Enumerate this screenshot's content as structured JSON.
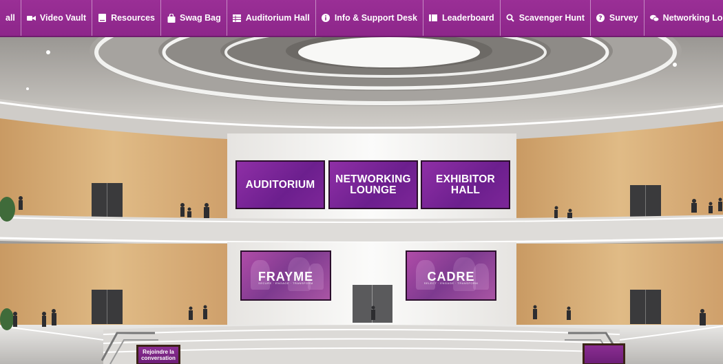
{
  "nav": {
    "items": [
      {
        "label": "all",
        "icon": ""
      },
      {
        "label": "Video Vault",
        "icon": "video-camera-icon"
      },
      {
        "label": "Resources",
        "icon": "book-icon"
      },
      {
        "label": "Swag Bag",
        "icon": "shopping-bag-icon"
      },
      {
        "label": "Auditorium Hall",
        "icon": "table-icon"
      },
      {
        "label": "Info & Support Desk",
        "icon": "info-circle-icon"
      },
      {
        "label": "Leaderboard",
        "icon": "list-icon"
      },
      {
        "label": "Scavenger Hunt",
        "icon": "search-icon"
      },
      {
        "label": "Survey",
        "icon": "question-circle-icon"
      },
      {
        "label": "Networking Lounge",
        "icon": "chat-bubbles-icon"
      }
    ]
  },
  "scene": {
    "screens": {
      "auditorium": "AUDITORIUM",
      "networking": "NETWORKING\nLOUNGE",
      "exhibitor": "EXHIBITOR\nHALL"
    },
    "brands": {
      "left": {
        "name": "FRAYME",
        "tagline": "SECURE · ENGAGE · TRANSFORM"
      },
      "right": {
        "name": "CADRE",
        "tagline": "SELECT · ENGAGE · TRANSFORM"
      }
    },
    "kiosk_left": "Rejoindre la\nconversation"
  },
  "colors": {
    "nav_bg": "#8d268a",
    "screen_purple": "#7a2596",
    "wood": "#d6ad78"
  }
}
